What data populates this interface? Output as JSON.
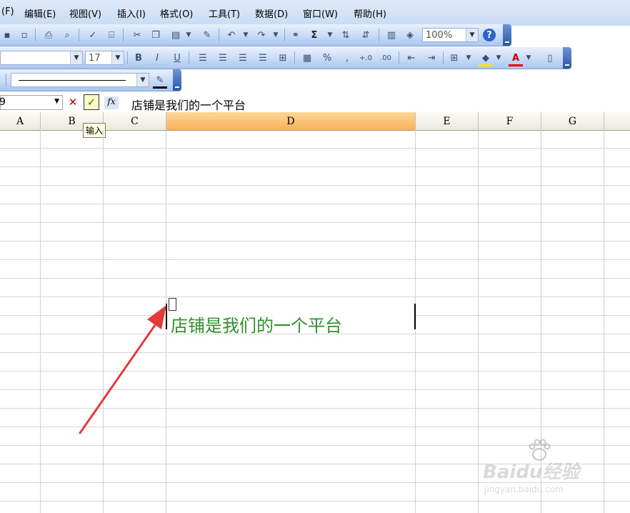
{
  "menu": [
    "(F)",
    "编辑(E)",
    "视图(V)",
    "插入(I)",
    "格式(O)",
    "工具(T)",
    "数据(D)",
    "窗口(W)",
    "帮助(H)"
  ],
  "toolbar1": {
    "zoom_value": "100%"
  },
  "toolbar2": {
    "font_value": "",
    "size_value": "17"
  },
  "formula_bar": {
    "name_box": "9",
    "cancel_label": "✕",
    "enter_label": "✓",
    "fx_label": "fx",
    "content": "店铺是我们的一个平台"
  },
  "tooltip": "输入",
  "columns": [
    "A",
    "B",
    "C",
    "D",
    "E",
    "F",
    "G"
  ],
  "selected_column": "D",
  "cell_edit_text": "店铺是我们的一个平台",
  "watermark": {
    "brand": "Baidu经验",
    "url": "jingyan.baidu.com"
  },
  "colors": {
    "edit_text": "#2f8f2a",
    "arrow": "#e43b3b",
    "selected_header": "#f8b25a"
  }
}
